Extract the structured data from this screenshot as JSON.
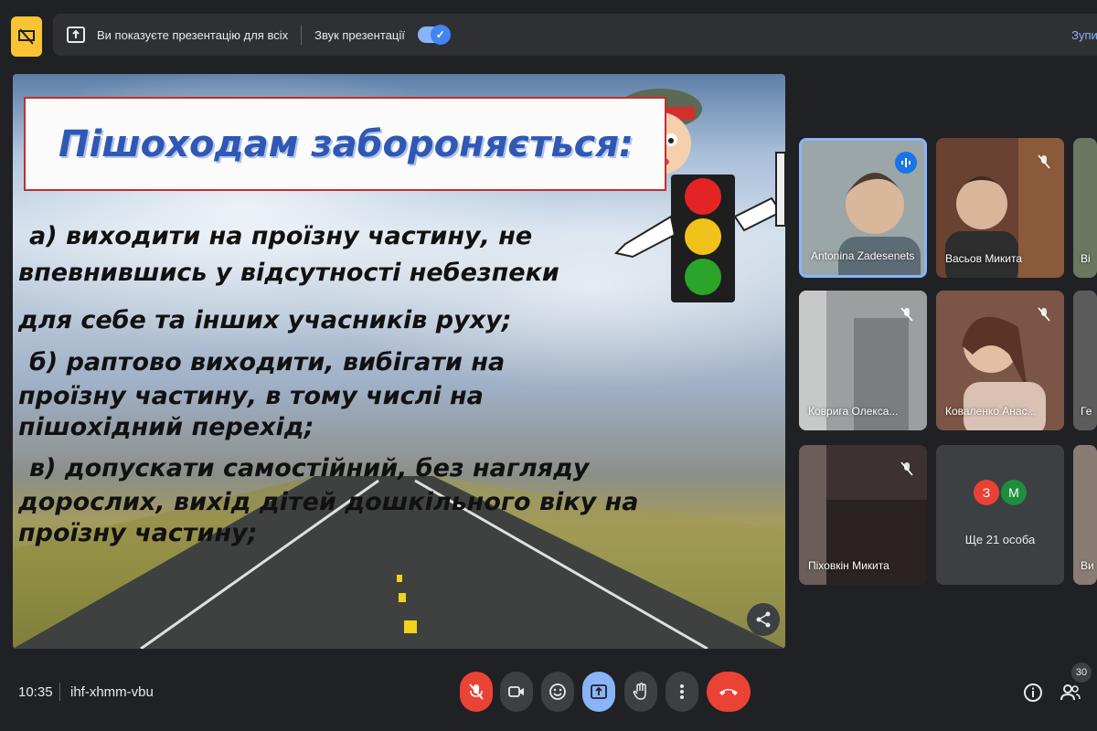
{
  "top_bar": {
    "presenting_text": "Ви показуєте презентацію для всіх",
    "sound_label": "Звук презентації",
    "sound_enabled": true,
    "stop_label": "Зупин"
  },
  "slide": {
    "title": "Пішоходам забороняється:",
    "lines": [
      "а) виходити на проїзну частину, не",
      "впевнившись у відсутності небезпеки",
      "для себе та інших учасників руху;",
      "б) раптово виходити, вибігати на",
      "проїзну частину, в тому числі на",
      "пішохідний перехід;",
      "в) допускати самостійний, без нагляду",
      "дорослих, вихід дітей дошкільного віку на",
      "проїзну частину;"
    ],
    "share_icon": "share-icon"
  },
  "participants": [
    {
      "name": "Antonina Zadesenets",
      "status": "speaking",
      "bg": "#7a8a8f"
    },
    {
      "name": "Васьов Микита",
      "status": "muted",
      "bg": "#5a3b2e"
    },
    {
      "name": "Ві",
      "status": "muted",
      "bg": "#6b7760"
    },
    {
      "name": "Коврига Олекса...",
      "status": "muted",
      "bg": "#8a8d8e"
    },
    {
      "name": "Коваленко Анас...",
      "status": "muted",
      "bg": "#6e4a3b"
    },
    {
      "name": "Ге",
      "status": "none",
      "bg": "#5c5c5c"
    },
    {
      "name": "Піховкін Микита",
      "status": "muted",
      "bg": "#2e2424"
    },
    {
      "name": "Ще 21 особа",
      "status": "more",
      "bg": "#3c4043",
      "avatars": [
        {
          "letter": "З",
          "color": "#e94235"
        },
        {
          "letter": "М",
          "color": "#1e8e3e"
        }
      ]
    },
    {
      "name": "Ви",
      "status": "none",
      "bg": "#8a7b75"
    }
  ],
  "bottom_bar": {
    "time": "10:35",
    "meeting_code": "ihf-xhmm-vbu",
    "participant_count": "30"
  },
  "colors": {
    "accent": "#8ab4f8",
    "danger": "#ea4335",
    "present_icon_bg": "#f9c433"
  }
}
